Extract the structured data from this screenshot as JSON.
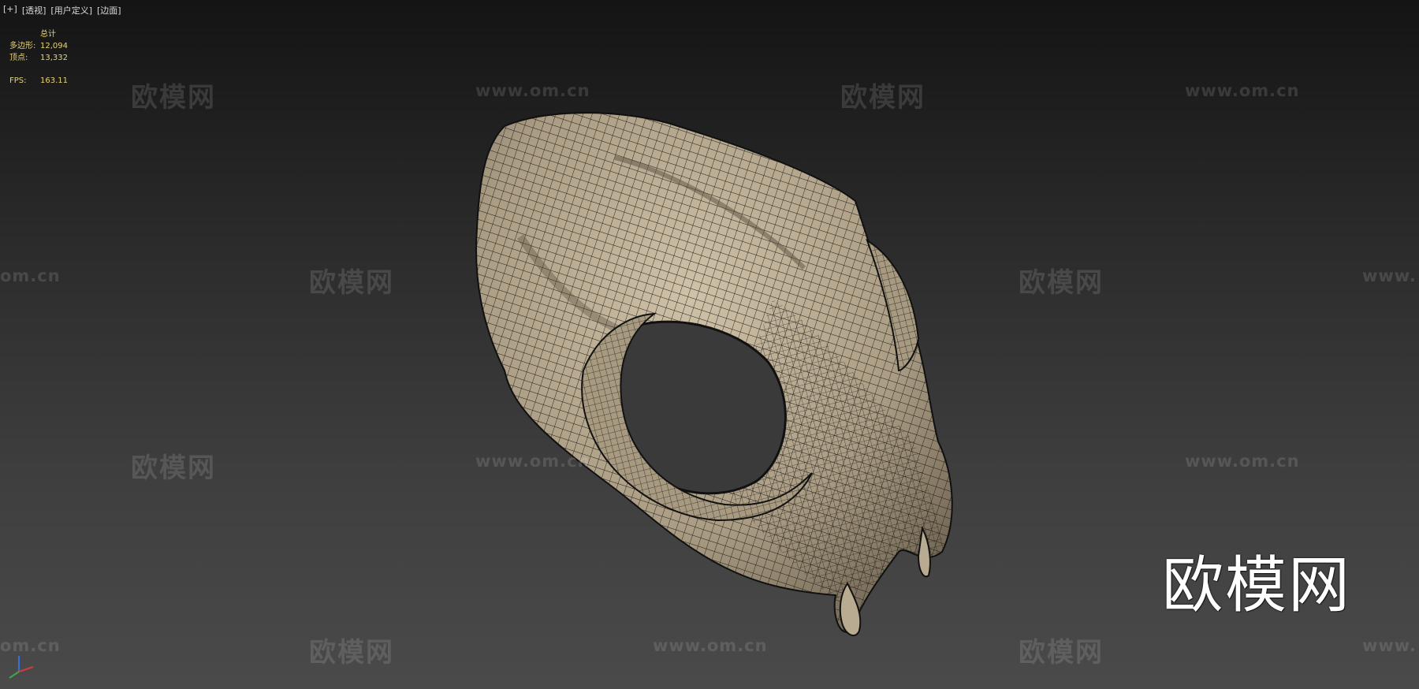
{
  "viewport": {
    "labels": [
      "[+]",
      "[透视]",
      "[用户定义]",
      "[边面]"
    ]
  },
  "stats": {
    "header": "总计",
    "polygons_label": "多边形:",
    "polygons_value": "12,094",
    "vertices_label": "顶点:",
    "vertices_value": "13,332",
    "fps_label": "FPS:",
    "fps_value": "163.11"
  },
  "watermark": {
    "cn": "欧模网",
    "url": "www.om.cn",
    "url_partial_left": "om.cn",
    "url_partial_right": "www."
  },
  "logo": {
    "text": "欧模网"
  },
  "colors": {
    "stats_text": "#e6d27a",
    "mesh_fill": "#b5a78e",
    "wire": "#1a1a1a"
  },
  "icons": {
    "axis": "xyz-axis-gizmo-icon"
  }
}
